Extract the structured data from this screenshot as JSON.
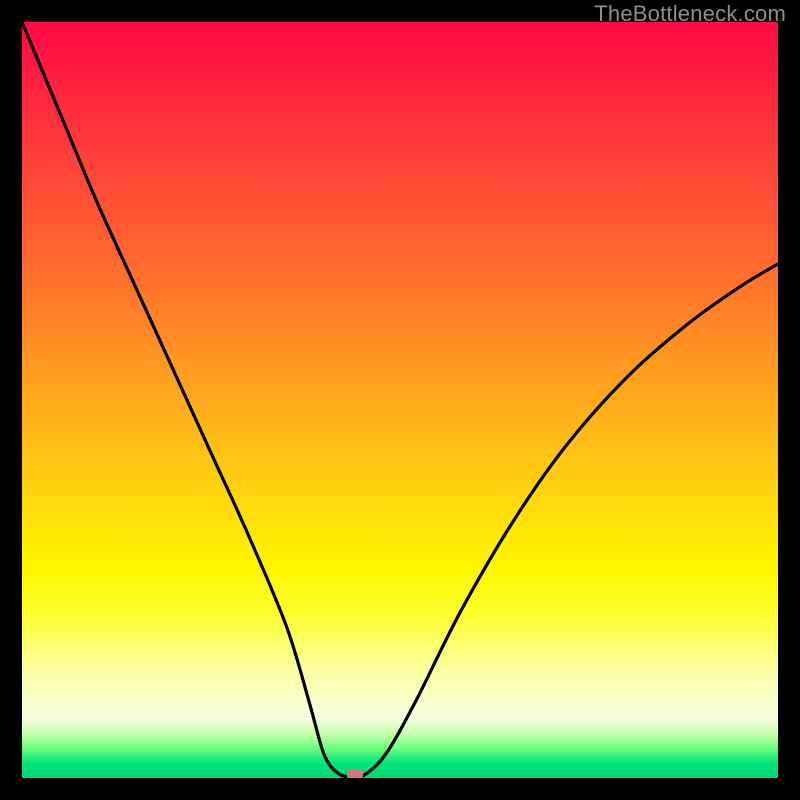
{
  "watermark": "TheBottleneck.com",
  "chart_data": {
    "type": "line",
    "title": "",
    "xlabel": "",
    "ylabel": "",
    "xlim": [
      0,
      100
    ],
    "ylim": [
      0,
      100
    ],
    "curve": {
      "x": [
        0,
        5,
        10,
        15,
        20,
        25,
        30,
        35,
        38,
        40,
        42,
        44,
        45,
        48,
        52,
        58,
        65,
        72,
        80,
        88,
        95,
        100
      ],
      "y": [
        100,
        88,
        76,
        65,
        54,
        43,
        32,
        20,
        10,
        3,
        0.5,
        0.2,
        0.2,
        3,
        10,
        22,
        34,
        44,
        53,
        60,
        65,
        68
      ]
    },
    "marker": {
      "x": 44,
      "y": 0.5
    },
    "background_gradient": {
      "stops": [
        {
          "pos": 0.0,
          "color": "#ff0b45"
        },
        {
          "pos": 0.32,
          "color": "#ff6a2e"
        },
        {
          "pos": 0.62,
          "color": "#ffd40f"
        },
        {
          "pos": 0.78,
          "color": "#fdff29"
        },
        {
          "pos": 0.92,
          "color": "#f8ffe0"
        },
        {
          "pos": 1.0,
          "color": "#00d876"
        }
      ]
    }
  }
}
